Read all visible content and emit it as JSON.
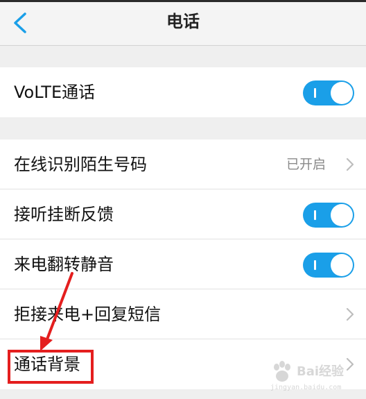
{
  "header": {
    "title": "电话",
    "back_icon": "back-chevron-icon"
  },
  "groups": [
    {
      "items": [
        {
          "label": "VoLTE通话",
          "control": "toggle",
          "on": true
        }
      ]
    },
    {
      "items": [
        {
          "label": "在线识别陌生号码",
          "control": "value",
          "value": "已开启"
        },
        {
          "label": "接听挂断反馈",
          "control": "toggle",
          "on": true
        },
        {
          "label": "来电翻转静音",
          "control": "toggle",
          "on": true
        },
        {
          "label": "拒接来电+回复短信",
          "control": "chevron"
        },
        {
          "label": "通话背景",
          "control": "chevron"
        }
      ]
    }
  ],
  "annotation": {
    "highlighted_item": "通话背景",
    "color": "#e41e1e"
  },
  "watermark": {
    "text": "Bai经验",
    "url": "jingyan.baidu.com"
  },
  "colors": {
    "accent": "#1a9fe8",
    "background": "#efefef",
    "row": "#ffffff"
  }
}
